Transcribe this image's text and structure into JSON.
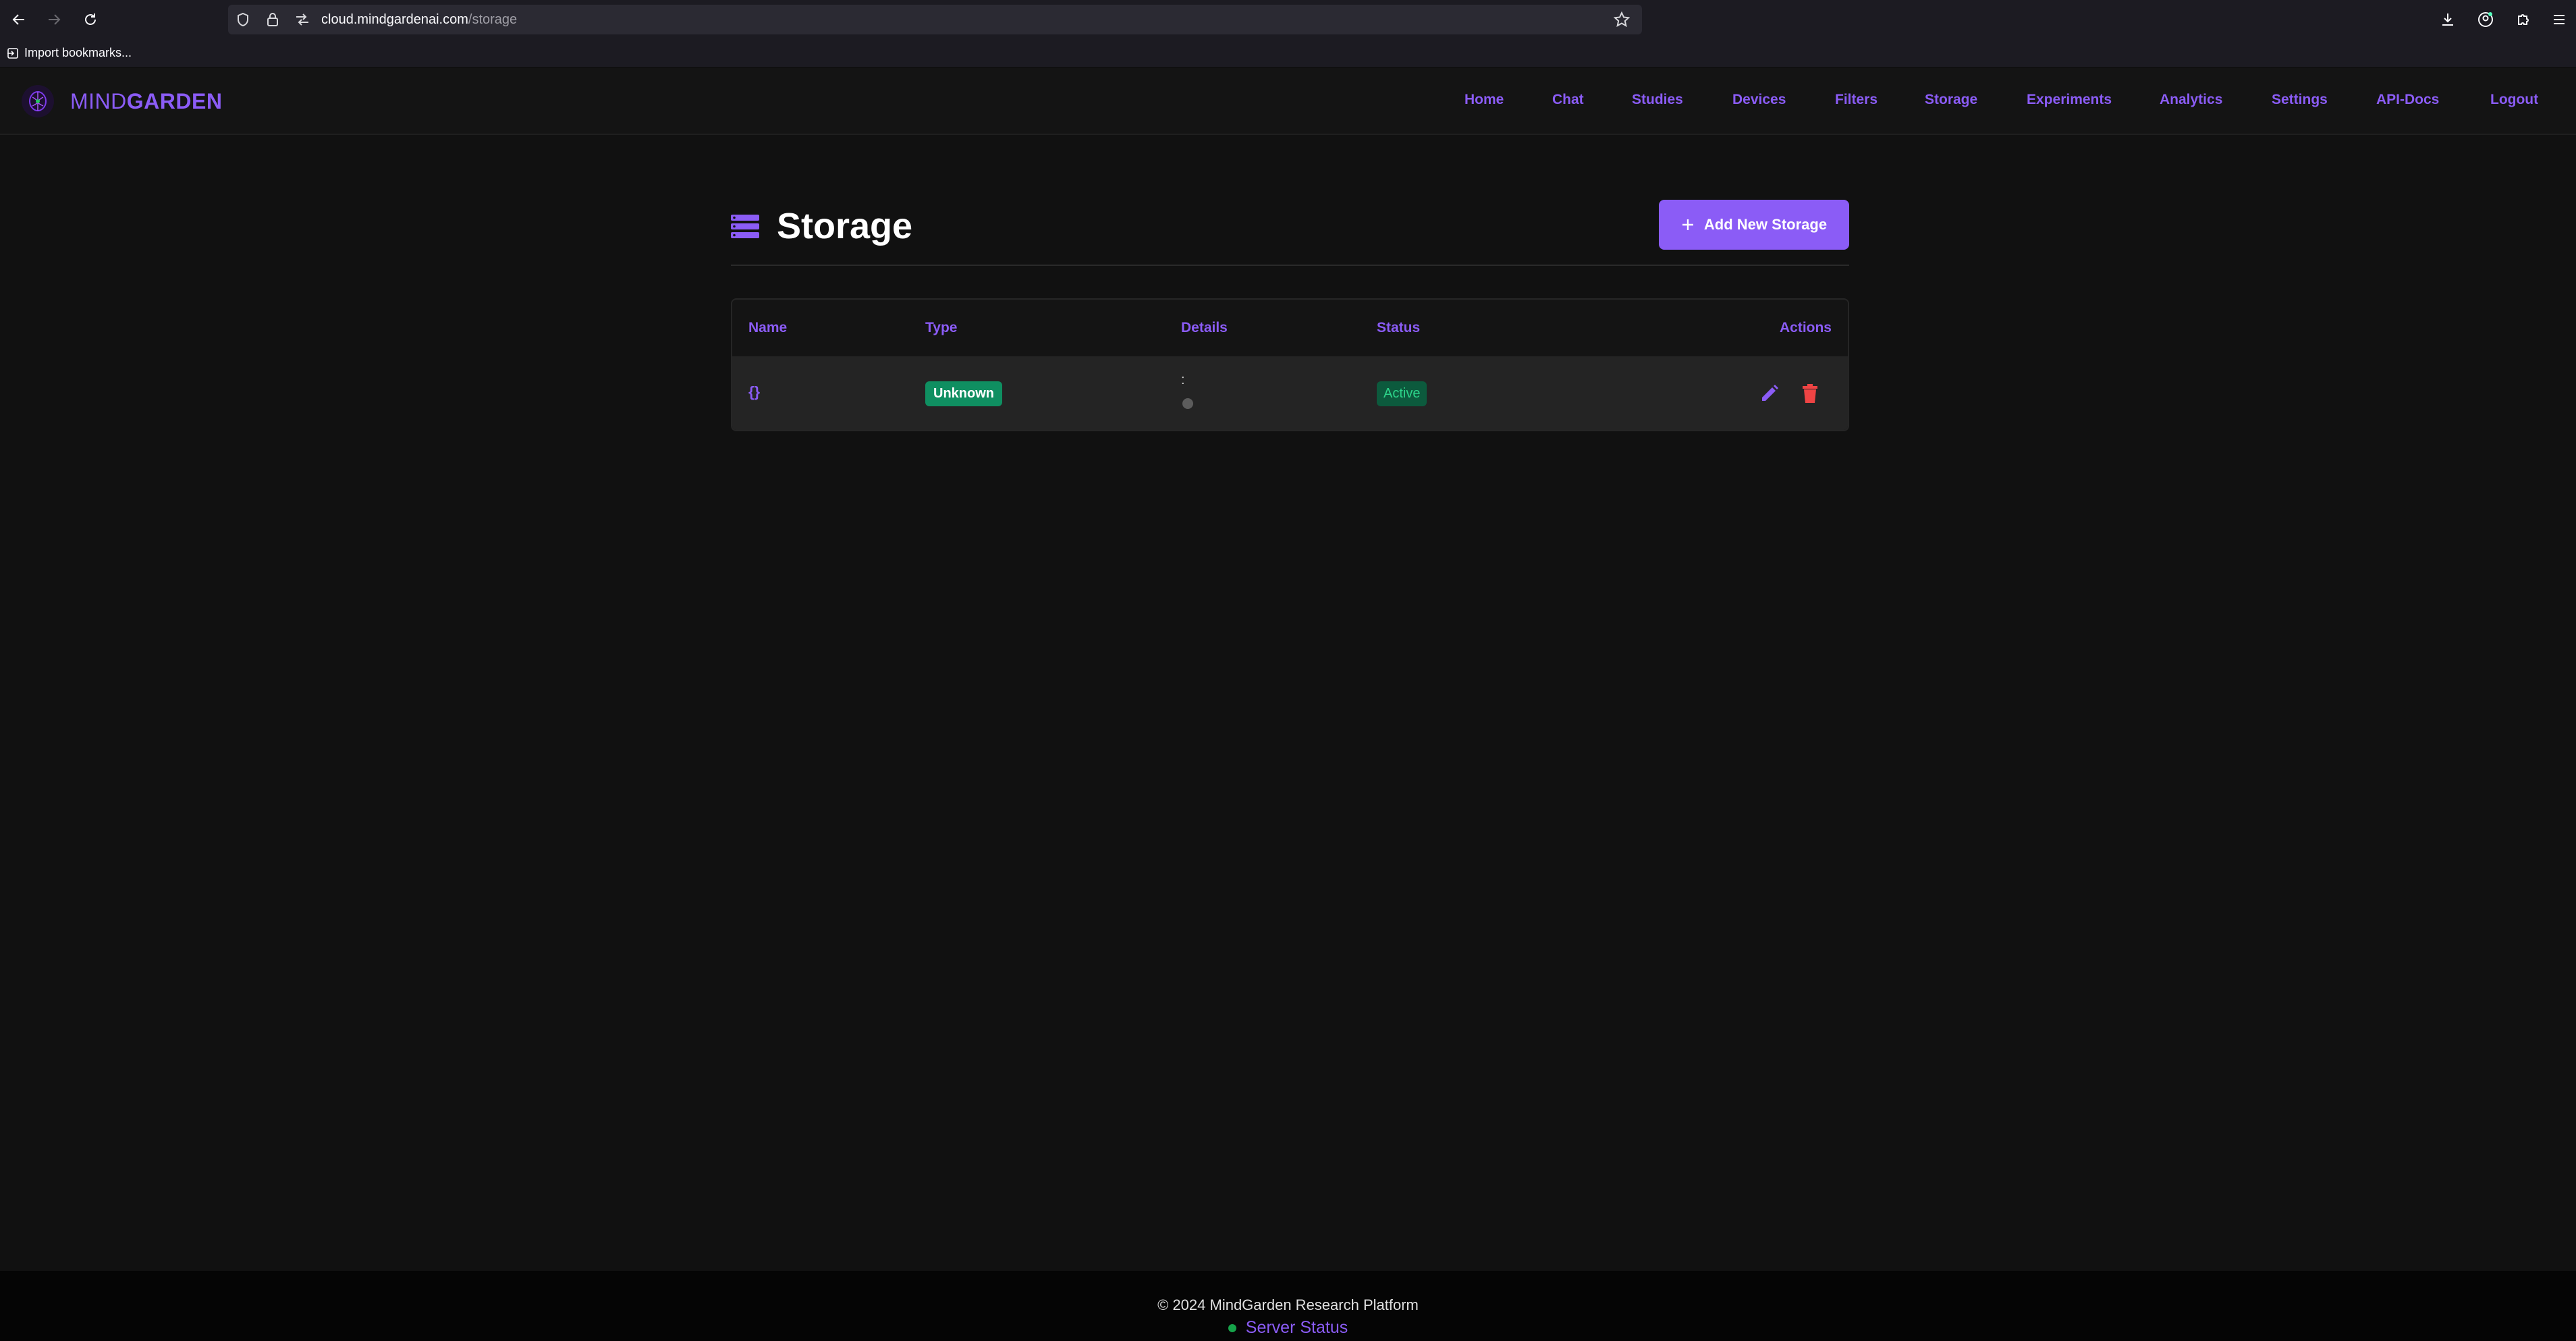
{
  "browser": {
    "url_host": "cloud.mindgardenai.com",
    "url_path": "/storage",
    "bookmark_label": "Import bookmarks..."
  },
  "brand": {
    "name_light": "MIND",
    "name_bold": "GARDEN"
  },
  "nav": {
    "items": [
      "Home",
      "Chat",
      "Studies",
      "Devices",
      "Filters",
      "Storage",
      "Experiments",
      "Analytics",
      "Settings",
      "API-Docs",
      "Logout"
    ]
  },
  "page": {
    "title": "Storage",
    "add_button_label": "Add New Storage"
  },
  "table": {
    "columns": [
      "Name",
      "Type",
      "Details",
      "Status",
      "Actions"
    ],
    "rows": [
      {
        "name": "{}",
        "type": "Unknown",
        "details": ":",
        "status": "Active"
      }
    ]
  },
  "footer": {
    "copyright": "© 2024 MindGarden Research Platform",
    "status_link": "Server Status"
  },
  "colors": {
    "accent": "#8b5cf6",
    "background": "#111111",
    "type_badge": "#0f8f61",
    "status_badge": "#0c5a3d",
    "delete": "#ef4444"
  }
}
